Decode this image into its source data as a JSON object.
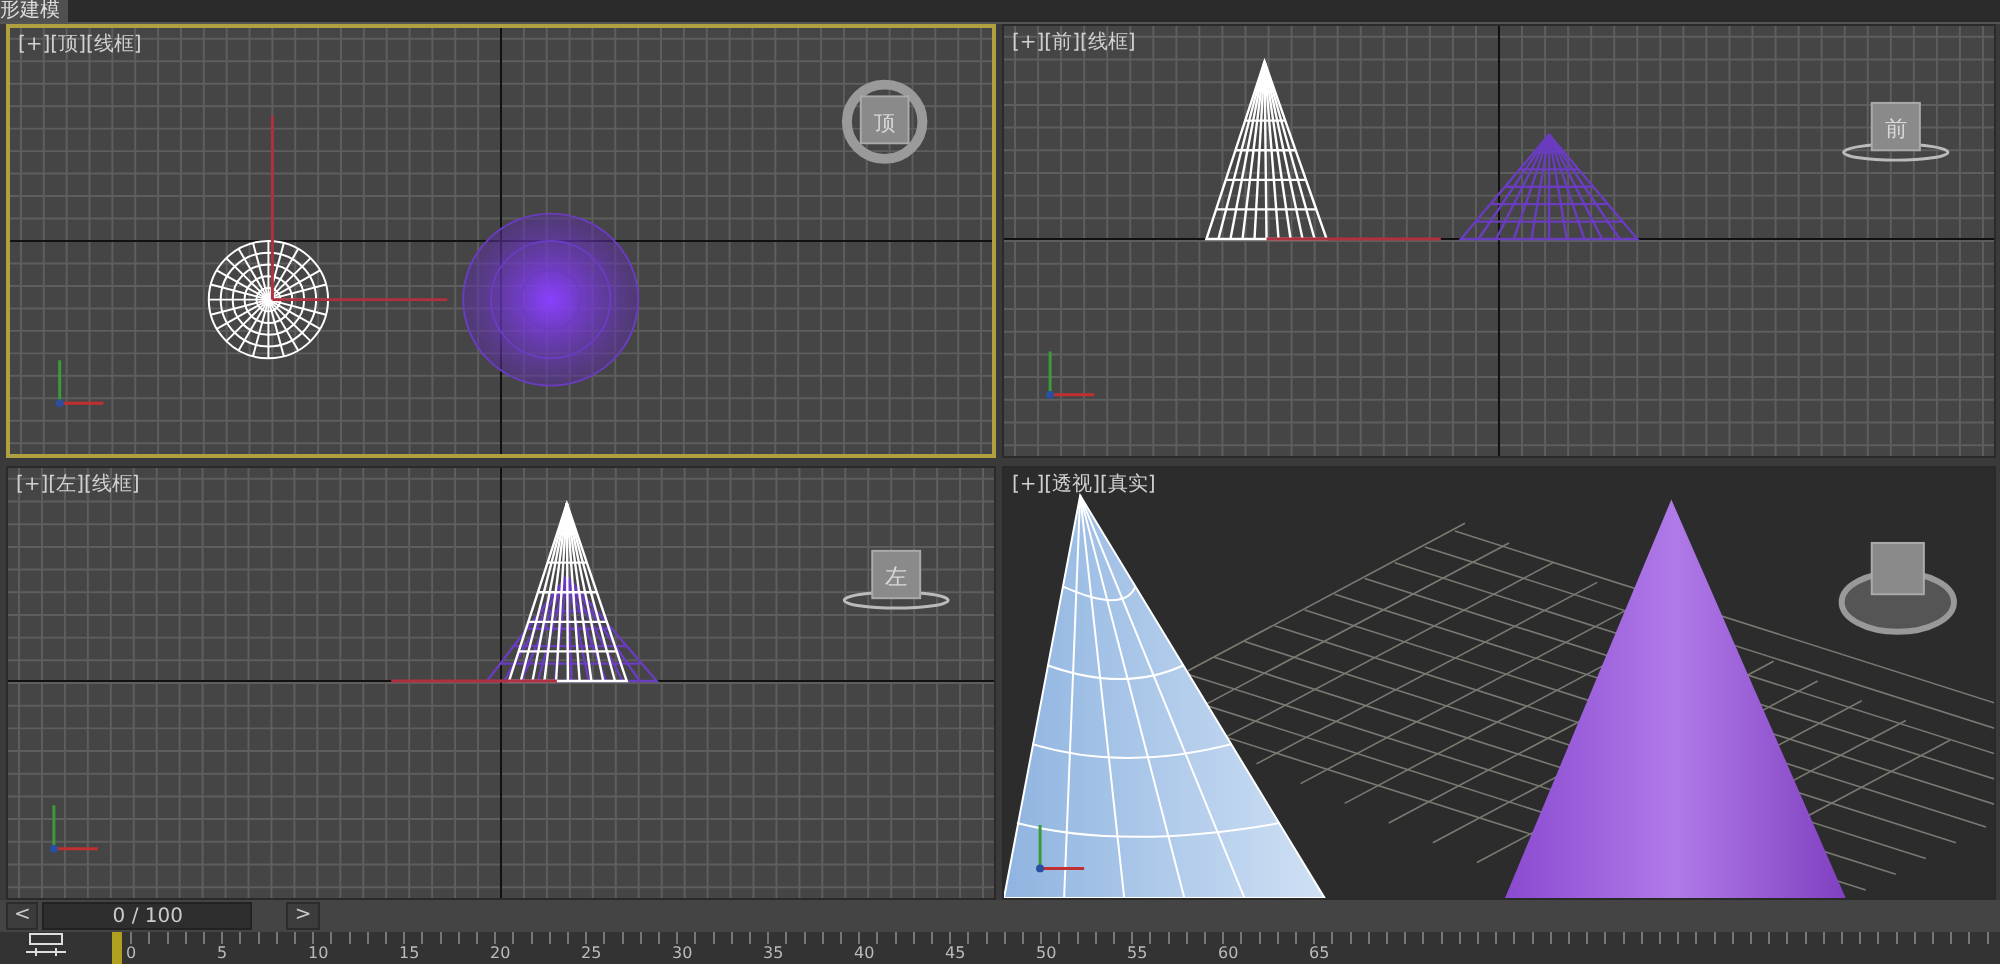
{
  "ribbon_tab": {
    "label": "形建模"
  },
  "viewports": [
    {
      "kind": "top",
      "label": "[+][顶][线框]",
      "cube_label": "顶",
      "selected": true
    },
    {
      "kind": "front",
      "label": "[+][前][线框]",
      "cube_label": "前",
      "selected": false
    },
    {
      "kind": "left",
      "label": "[+][左][线框]",
      "cube_label": "左",
      "selected": false
    },
    {
      "kind": "perspective",
      "label": "[+][透视][真实]",
      "selected": false
    }
  ],
  "time_slider": {
    "prev": "<",
    "position": "0 / 100",
    "next": ">",
    "level": 0
  },
  "track_bar": {
    "ticks": [
      "0",
      "5",
      "10",
      "15",
      "20",
      "25",
      "30",
      "35",
      "40",
      "45",
      "50",
      "55",
      "60",
      "65"
    ]
  }
}
